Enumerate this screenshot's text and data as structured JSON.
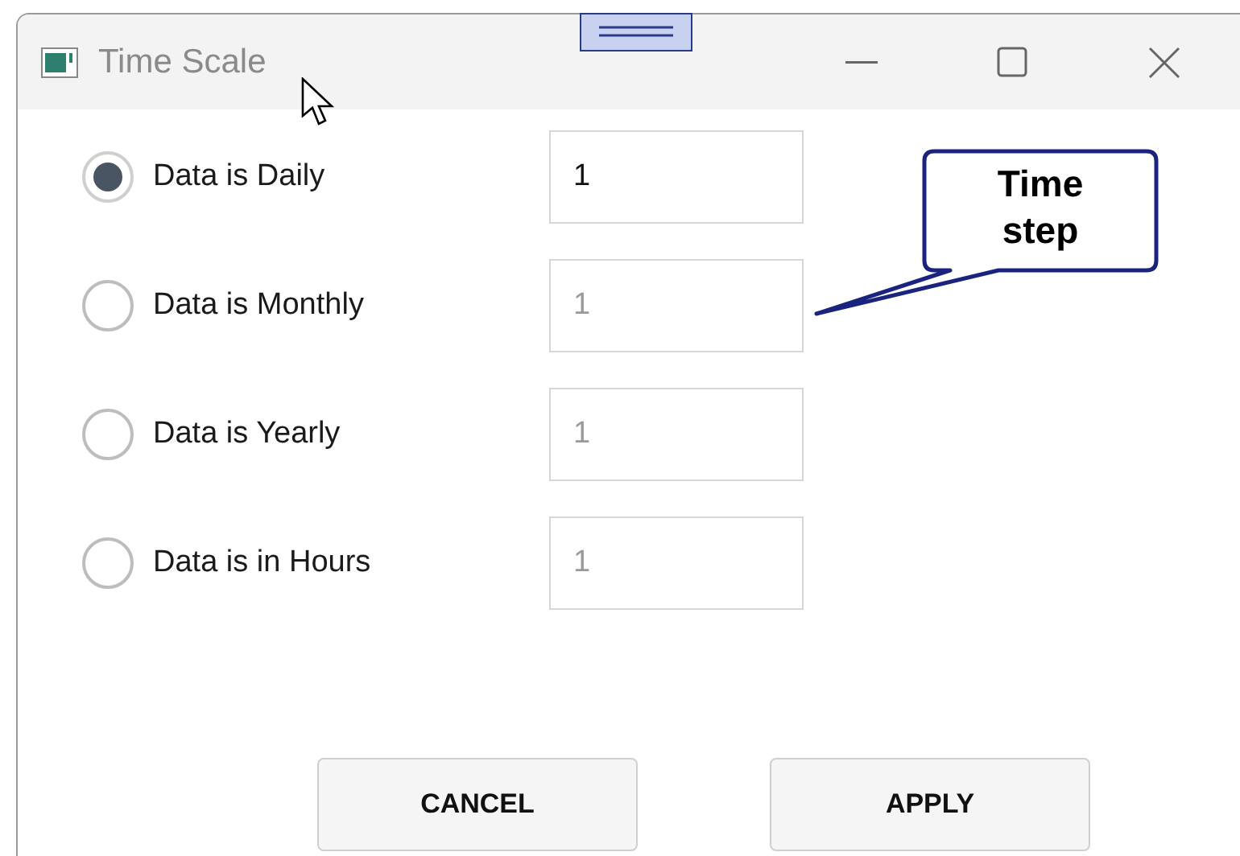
{
  "window": {
    "title": "Time Scale"
  },
  "options": [
    {
      "label": "Data is Daily",
      "selected": true,
      "value": "1",
      "disabled": false
    },
    {
      "label": "Data is Monthly",
      "selected": false,
      "value": "1",
      "disabled": true
    },
    {
      "label": "Data is Yearly",
      "selected": false,
      "value": "1",
      "disabled": true
    },
    {
      "label": "Data is in Hours",
      "selected": false,
      "value": "1",
      "disabled": true
    }
  ],
  "callout": {
    "lines": [
      "Time",
      "step"
    ]
  },
  "buttons": [
    "CANCEL",
    "APPLY"
  ]
}
